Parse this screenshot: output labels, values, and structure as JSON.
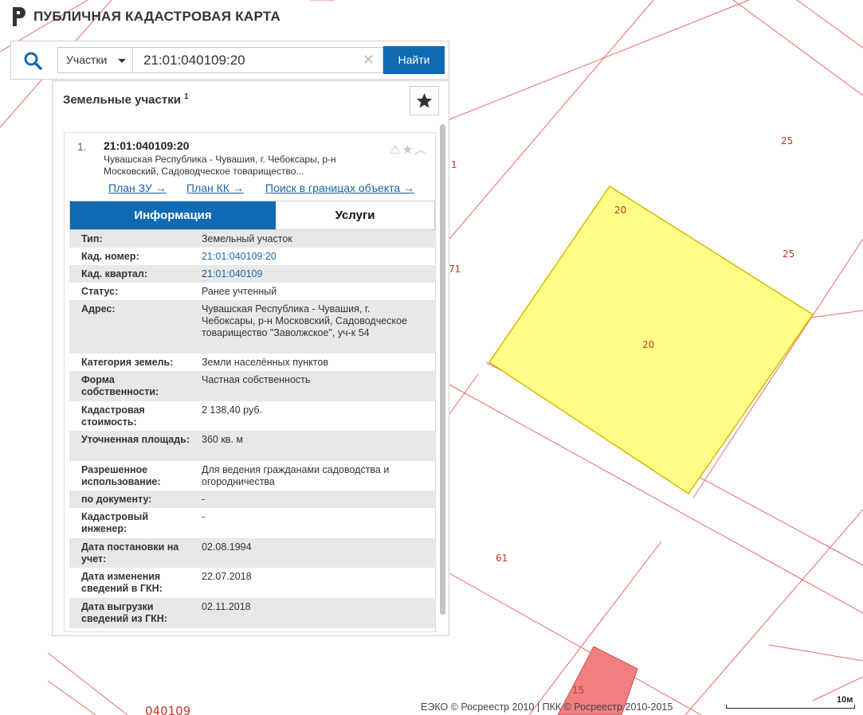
{
  "app": {
    "title": "ПУБЛИЧНАЯ КАДАСТРОВАЯ КАРТА"
  },
  "search": {
    "type_label": "Участки",
    "query": "21:01:040109:20",
    "clear_icon": "close-icon",
    "find_label": "Найти"
  },
  "panel": {
    "title": "Земельные участки",
    "count": "1",
    "result": {
      "number": "1.",
      "cad_number": "21:01:040109:20",
      "address_short": "Чувашская Республика - Чувашия, г. Чебоксары, р-н Московский, Садоводческое товарищество...",
      "links": [
        "План ЗУ →",
        "План КК →",
        "Поиск в границах объекта →"
      ]
    },
    "tabs": [
      "Информация",
      "Услуги"
    ],
    "info": [
      {
        "k": "Тип:",
        "v": "Земельный участок"
      },
      {
        "k": "Кад. номер:",
        "v": "21:01:040109:20",
        "link": true
      },
      {
        "k": "Кад. квартал:",
        "v": "21:01:040109",
        "link": true
      },
      {
        "k": "Статус:",
        "v": "Ранее учтенный"
      },
      {
        "k": "Адрес:",
        "v": "Чувашская Республика - Чувашия, г. Чебоксары, р-н Московский, Садоводческое товарищество \"Заволжское\", уч-к 54"
      },
      {
        "k": "Категория земель:",
        "v": "Земли населённых пунктов"
      },
      {
        "k": "Форма собственности:",
        "v": "Частная собственность"
      },
      {
        "k": "Кадастровая стоимость:",
        "v": "2 138,40 руб."
      },
      {
        "k": "Уточненная площадь:",
        "v": "360 кв. м"
      },
      {
        "k": "Разрешенное использование:",
        "v": "Для ведения гражданами садоводства и огородничества"
      },
      {
        "k": "по документу:",
        "v": "-"
      },
      {
        "k": "Кадастровый инженер:",
        "v": "-"
      },
      {
        "k": "Дата постановки на учет:",
        "v": "02.08.1994"
      },
      {
        "k": "Дата изменения сведений в ГКН:",
        "v": "22.07.2018"
      },
      {
        "k": "Дата выгрузки сведений из ГКН:",
        "v": "02.11.2018"
      }
    ]
  },
  "map": {
    "labels": [
      "25",
      "20",
      "25",
      "20",
      "1",
      "71",
      "61",
      "15",
      "040109"
    ],
    "colors": {
      "parcel_border": "#e05555",
      "selected_fill": "#ffff88",
      "selected_border": "#d4b800",
      "red_parcel": "#f08080"
    }
  },
  "footer": {
    "attribution": "ЕЭКО © Росреестр 2010 | ПКК © Росреестр 2010-2015",
    "scale": "10м"
  }
}
